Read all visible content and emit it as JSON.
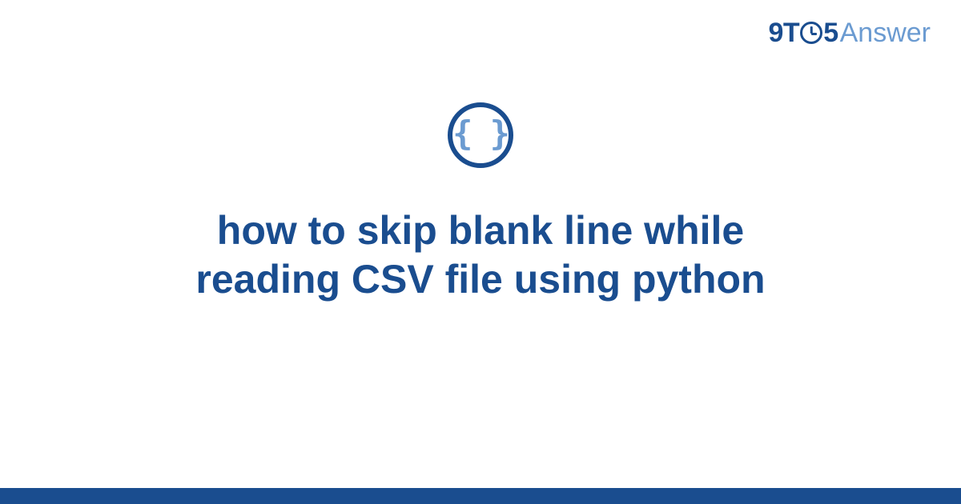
{
  "logo": {
    "part_9t": "9T",
    "part_5": "5",
    "part_answer": "Answer"
  },
  "icon": {
    "braces": "{ }"
  },
  "heading": "how to skip blank line while reading CSV file using python",
  "colors": {
    "primary": "#1a4d8f",
    "secondary": "#6b9bd1",
    "background": "#ffffff"
  }
}
